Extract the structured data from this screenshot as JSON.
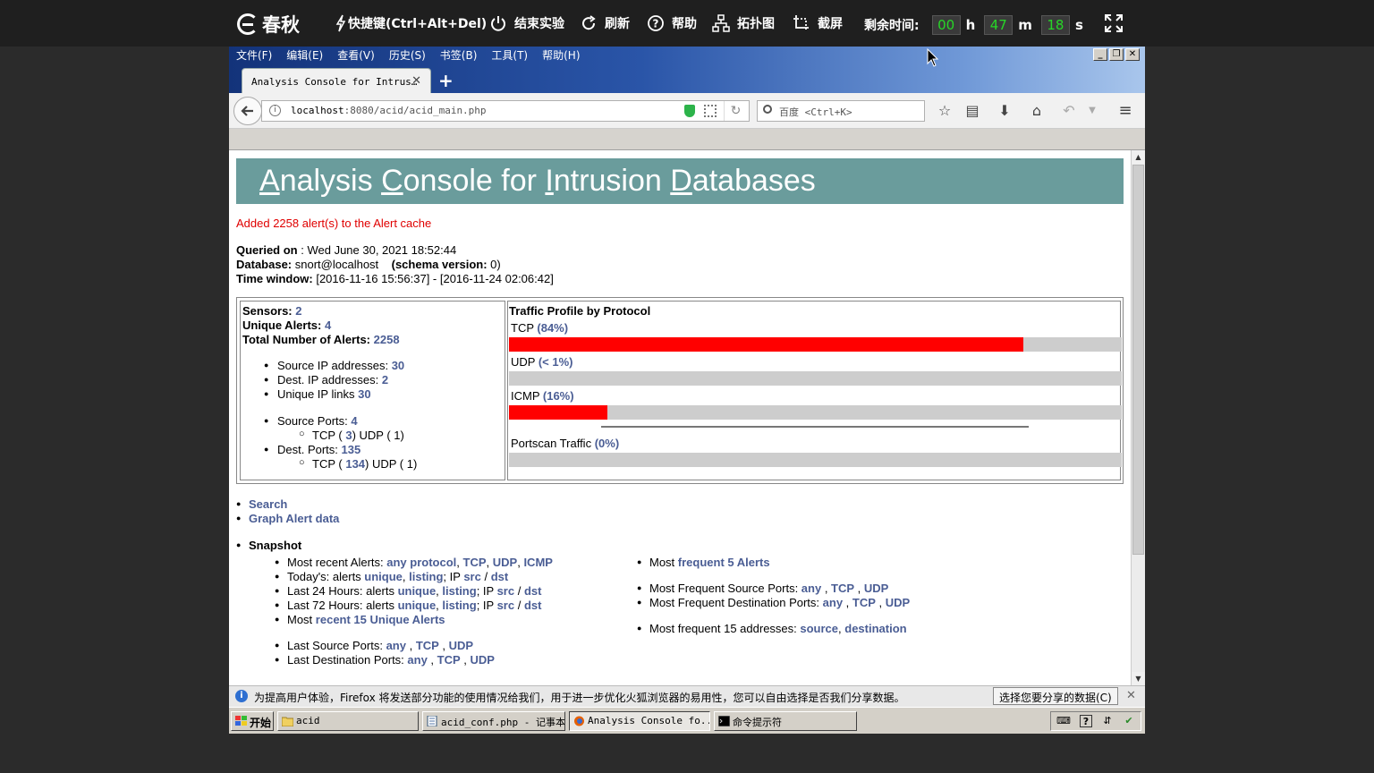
{
  "topbar": {
    "logo": "春秋",
    "shortcut": "快捷键(Ctrl+Alt+Del)",
    "end": "结束实验",
    "refresh": "刷新",
    "help": "帮助",
    "topology": "拓扑图",
    "screenshot": "截屏",
    "remaining_label": "剩余时间:",
    "hours": "00",
    "h": "h",
    "minutes": "47",
    "m": "m",
    "seconds": "18",
    "s": "s"
  },
  "browser": {
    "menu": [
      "文件(F)",
      "编辑(E)",
      "查看(V)",
      "历史(S)",
      "书签(B)",
      "工具(T)",
      "帮助(H)"
    ],
    "tab_title": "Analysis Console for Intrus…",
    "url_host": "localhost",
    "url_rest": ":8080/acid/acid_main.php",
    "search_placeholder": "百度 <Ctrl+K>"
  },
  "page": {
    "header_parts": [
      {
        "u": "A",
        "t": "nalysis "
      },
      {
        "u": "C",
        "t": "onsole for "
      },
      {
        "u": "I",
        "t": "ntrusion "
      },
      {
        "u": "D",
        "t": "atabases"
      }
    ],
    "cache_msg": "Added 2258 alert(s) to the Alert cache",
    "queried_label": "Queried on",
    "queried_value": " : Wed June 30, 2021 18:52:44",
    "database_label": "Database:",
    "database_value": " snort@localhost",
    "schema_label": "(schema version:",
    "schema_value": " 0)",
    "time_label": "Time window:",
    "time_value": " [2016-11-16 15:56:37] - [2016-11-24 02:06:42]",
    "stats": {
      "sensors_label": "Sensors:",
      "sensors": "2",
      "unique_label": "Unique Alerts:",
      "unique": "4",
      "total_label": "Total Number of Alerts:",
      "total": "2258",
      "src_ip_label": "Source IP addresses:",
      "src_ip": "30",
      "dst_ip_label": "Dest. IP addresses:",
      "dst_ip": "2",
      "ip_links_label": "Unique IP links",
      "ip_links": "30",
      "src_ports_label": "Source Ports:",
      "src_ports": "4",
      "src_tcp_label": "TCP (",
      "src_tcp": "3",
      "src_udp_label": ")  UDP (",
      "src_udp": " 1)",
      "dst_ports_label": "Dest. Ports:",
      "dst_ports": "135",
      "dst_tcp_label": "TCP (",
      "dst_tcp": "134",
      "dst_udp_label": ")  UDP (",
      "dst_udp": " 1)"
    },
    "traffic": {
      "title": "Traffic Profile by Protocol",
      "protocols": [
        {
          "name": "TCP",
          "pct_label": "(84%)",
          "fraction": 0.84
        },
        {
          "name": "UDP",
          "pct_label": "(< 1%)",
          "fraction": 0.0
        },
        {
          "name": "ICMP",
          "pct_label": "(16%)",
          "fraction": 0.16
        }
      ],
      "portscan_name": "Portscan Traffic",
      "portscan_pct": "(0%)",
      "portscan_fraction": 0.0
    },
    "links": {
      "search": "Search",
      "graph": "Graph Alert data",
      "snapshot": "Snapshot"
    },
    "snapshot": {
      "recent_alerts": "Most recent Alerts: ",
      "any_protocol": "any protocol",
      "tcp": "TCP",
      "udp": "UDP",
      "icmp": "ICMP",
      "todays": "Today's: alerts ",
      "last24": "Last 24 Hours: alerts ",
      "last72": "Last 72 Hours: alerts ",
      "unique": "unique",
      "listing": "listing",
      "ip": "; IP ",
      "src": "src",
      "dst": "dst",
      "most_recent15_pre": "Most ",
      "most_recent15": "recent 15 Unique Alerts",
      "last_src_ports": "Last Source Ports: ",
      "last_dst_ports": "Last Destination Ports: ",
      "any": "any",
      "most_frequent_pre": "Most ",
      "frequent5": "frequent 5 Alerts",
      "freq_src_ports": "Most Frequent Source Ports: ",
      "freq_dst_ports": "Most Frequent Destination Ports: ",
      "freq15": "Most frequent 15 addresses: ",
      "source": "source",
      "destination": "destination"
    }
  },
  "notification": {
    "text": "为提高用户体验，Firefox 将发送部分功能的使用情况给我们，用于进一步优化火狐浏览器的易用性，您可以自由选择是否我们分享数据。",
    "button": "选择您要分享的数据(C)"
  },
  "taskbar": {
    "start": "开始",
    "items": [
      "acid",
      "acid_conf.php - 记事本",
      "Analysis Console fo...",
      "命令提示符"
    ]
  }
}
